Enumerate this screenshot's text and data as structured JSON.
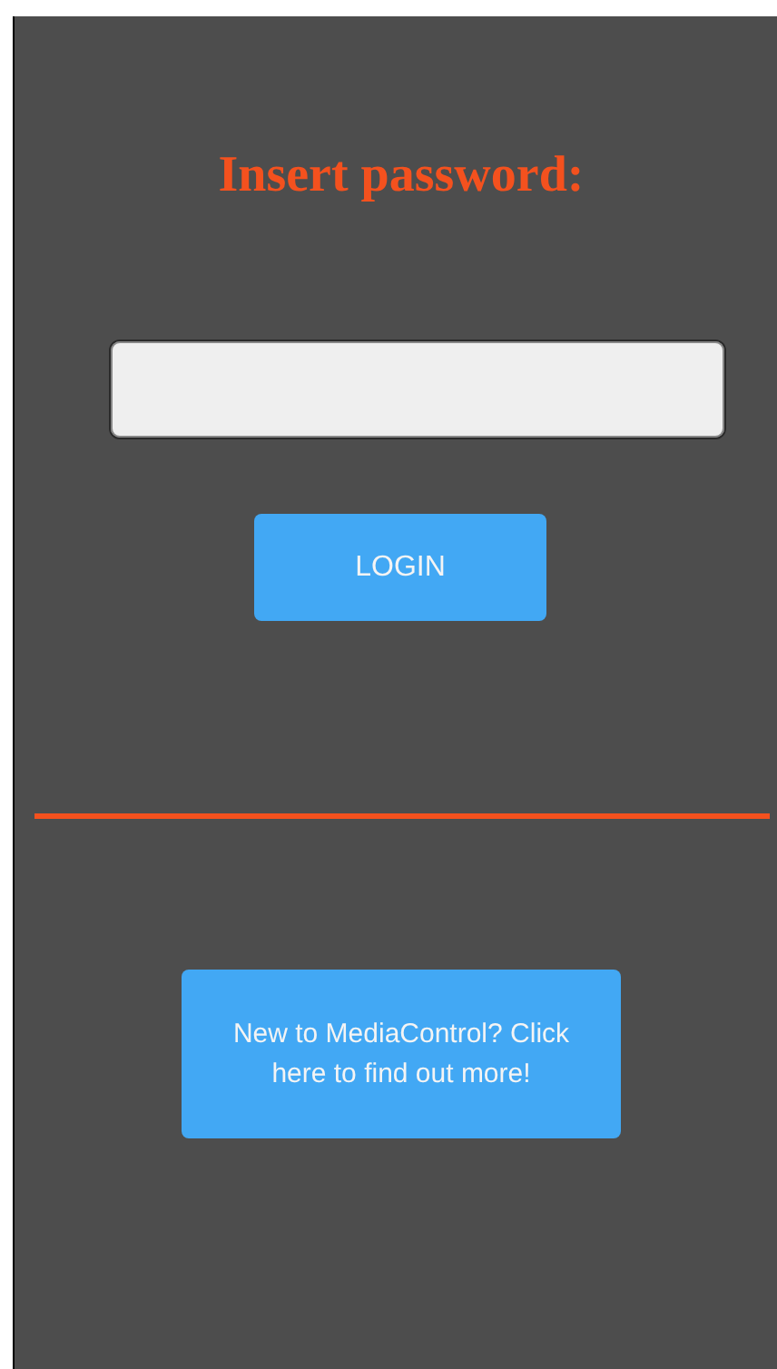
{
  "title": "Insert password:",
  "login_button": {
    "label": "LOGIN"
  },
  "info_button": {
    "label": "New to MediaControl? Click here to find out more!"
  }
}
